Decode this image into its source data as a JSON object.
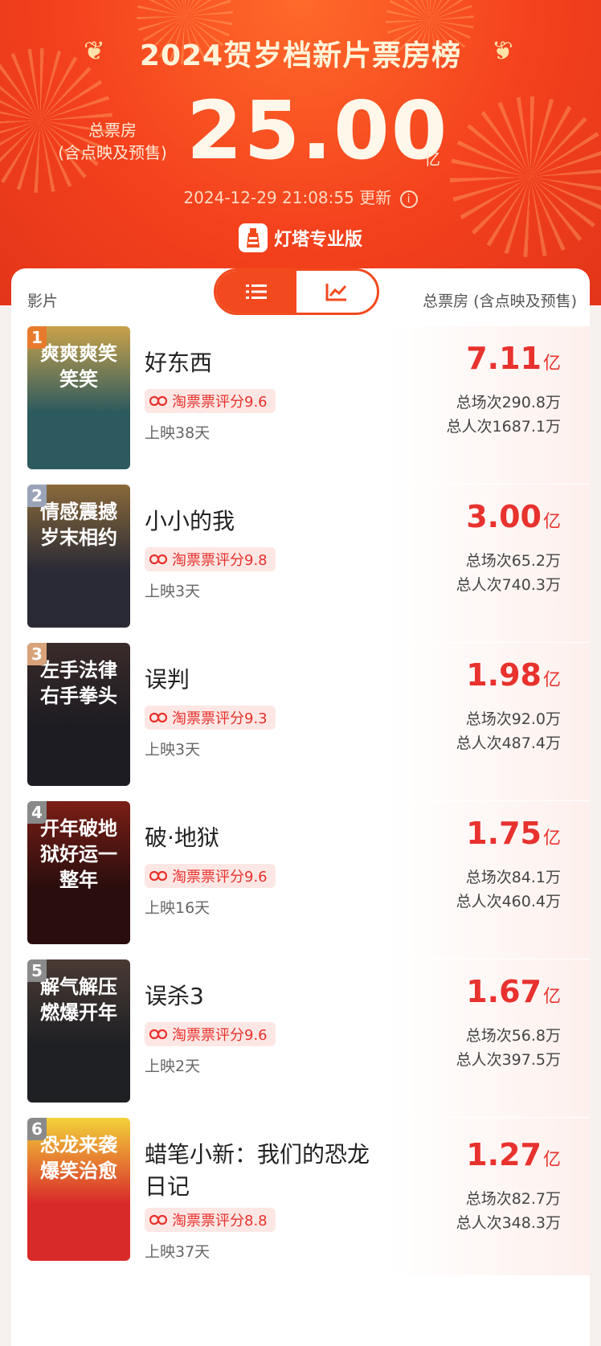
{
  "header": {
    "title": "2024贺岁档新片票房榜",
    "total_label_line1": "总票房",
    "total_label_line2": "(含点映及预售)",
    "total_value": "25.00",
    "total_unit": "亿",
    "update_time": "2024-12-29 21:08:55",
    "update_suffix": "更新",
    "brand": "灯塔专业版"
  },
  "list_header": {
    "film_label": "影片",
    "box_label": "总票房 (含点映及预售)",
    "view_modes": [
      "list-icon",
      "trend-chart-icon"
    ],
    "active_view": "list"
  },
  "colors": {
    "accent": "#f24a1e",
    "value_red": "#e8322e",
    "rating_bg": "#fde7e4"
  },
  "movies": [
    {
      "rank": "1",
      "title": "好东西",
      "poster_text": "爽爽爽笑笑笑",
      "rating": "淘票票评分9.6",
      "days": "上映38天",
      "box": "7.11",
      "box_unit": "亿",
      "shows": "总场次290.8万",
      "viewers": "总人次1687.1万",
      "poster_colors": [
        "#2d5a5e",
        "#c9a24a"
      ],
      "badge_color": "#e87a2e"
    },
    {
      "rank": "2",
      "title": "小小的我",
      "poster_text": "情感震撼岁末相约",
      "rating": "淘票票评分9.8",
      "days": "上映3天",
      "box": "3.00",
      "box_unit": "亿",
      "shows": "总场次65.2万",
      "viewers": "总人次740.3万",
      "poster_colors": [
        "#2a2a36",
        "#8a6a3a"
      ],
      "badge_color": "#9aa4b8"
    },
    {
      "rank": "3",
      "title": "误判",
      "poster_text": "左手法律 右手拳头",
      "rating": "淘票票评分9.3",
      "days": "上映3天",
      "box": "1.98",
      "box_unit": "亿",
      "shows": "总场次92.0万",
      "viewers": "总人次487.4万",
      "poster_colors": [
        "#1c1c22",
        "#3a2a2a"
      ],
      "badge_color": "#d8a27a"
    },
    {
      "rank": "4",
      "title": "破·地狱",
      "poster_text": "开年破地狱好运一整年",
      "rating": "淘票票评分9.6",
      "days": "上映16天",
      "box": "1.75",
      "box_unit": "亿",
      "shows": "总场次84.1万",
      "viewers": "总人次460.4万",
      "poster_colors": [
        "#2a0e0e",
        "#7a1e16"
      ],
      "badge_color": "#8a8a8a"
    },
    {
      "rank": "5",
      "title": "误杀3",
      "poster_text": "解气解压燃爆开年",
      "rating": "淘票票评分9.6",
      "days": "上映2天",
      "box": "1.67",
      "box_unit": "亿",
      "shows": "总场次56.8万",
      "viewers": "总人次397.5万",
      "poster_colors": [
        "#1e2024",
        "#4a3a34"
      ],
      "badge_color": "#8a8a8a"
    },
    {
      "rank": "6",
      "title": "蜡笔小新：我们的恐龙日记",
      "poster_text": "恐龙来袭爆笑治愈",
      "rating": "淘票票评分8.8",
      "days": "上映37天",
      "box": "1.27",
      "box_unit": "亿",
      "shows": "总场次82.7万",
      "viewers": "总人次348.3万",
      "poster_colors": [
        "#d92a2a",
        "#f2d23a"
      ],
      "badge_color": "#8a8a8a"
    }
  ]
}
